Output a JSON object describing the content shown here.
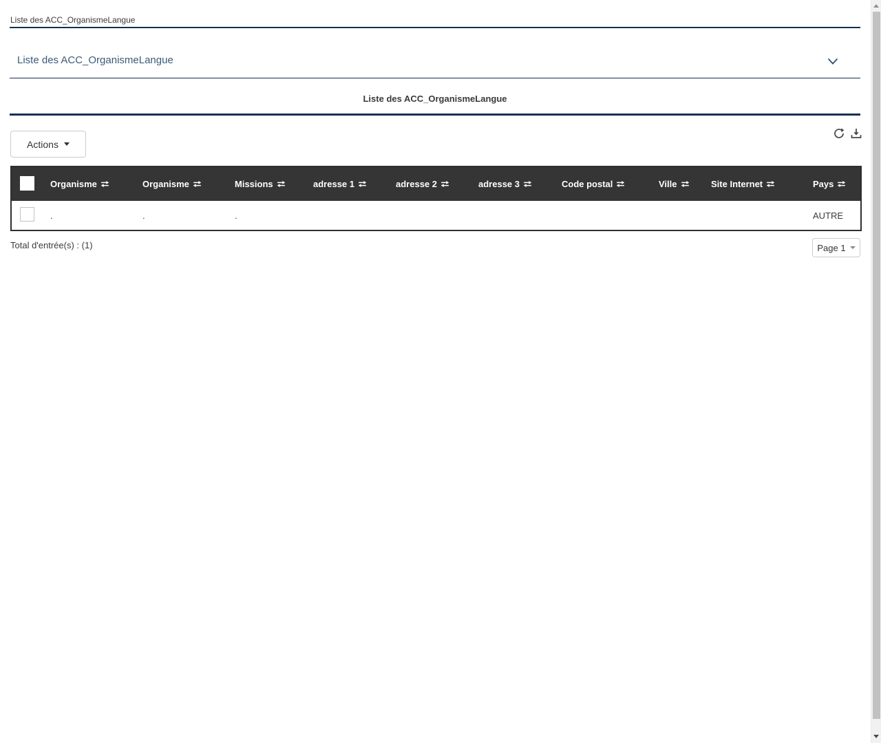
{
  "header": {
    "breadcrumb": "Liste des ACC_OrganismeLangue"
  },
  "panel": {
    "title": "Liste des ACC_OrganismeLangue",
    "chevron_icon": "chevron-down"
  },
  "section": {
    "title": "Liste des ACC_OrganismeLangue"
  },
  "toolbar": {
    "actions_label": "Actions",
    "icons": [
      "refresh-icon",
      "download-icon"
    ]
  },
  "table": {
    "columns": [
      "Organisme",
      "Organisme",
      "Missions",
      "adresse 1",
      "adresse 2",
      "adresse 3",
      "Code postal",
      "Ville",
      "Site Internet",
      "Pays"
    ],
    "sort_icon": "sort-exchange-icon",
    "rows": [
      {
        "cells": [
          ".",
          ".",
          ".",
          "",
          "",
          "",
          "",
          "",
          "",
          "AUTRE"
        ]
      }
    ]
  },
  "footer": {
    "total_label": "Total d'entrée(s) : (1)",
    "page_label": "Page 1"
  },
  "colors": {
    "accent_navy": "#132f52",
    "table_header_bg": "#353535",
    "panel_title_text": "#3c5a76",
    "body_text": "#3a3a3a",
    "button_border": "#cccccc",
    "scrollbar_thumb": "#c1c1c1"
  }
}
